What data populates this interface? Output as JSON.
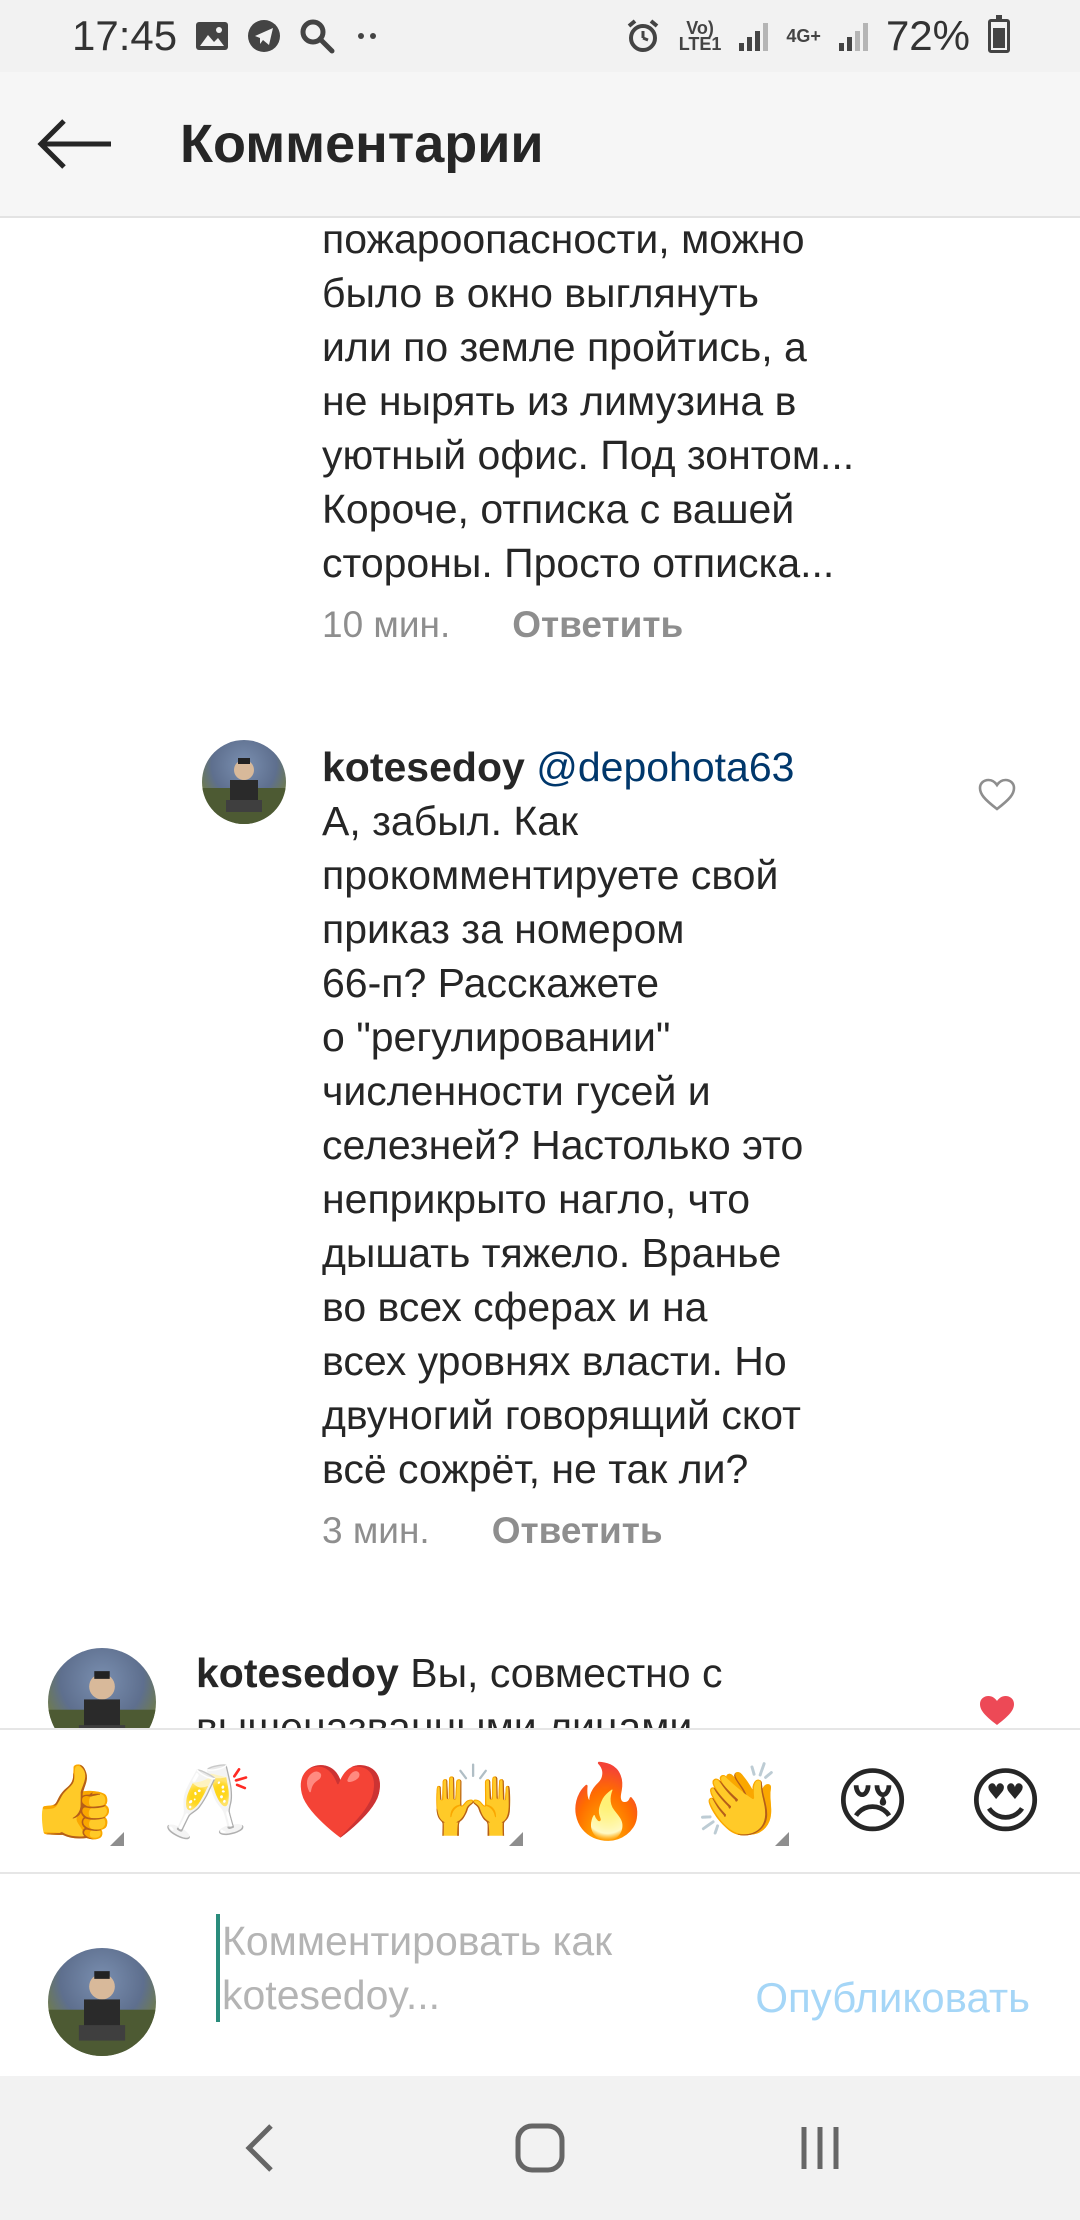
{
  "status_bar": {
    "time": "17:45",
    "battery": "72%",
    "lte_label_top": "Vo)",
    "lte_label_bottom": "LTE1",
    "net_label": "4G+",
    "icons": [
      "image-icon",
      "telegram-icon",
      "search-icon",
      "more-dots-icon",
      "alarm-icon",
      "signal-icon",
      "battery-icon"
    ]
  },
  "header": {
    "title": "Комментарии",
    "back_icon": "back-arrow-icon"
  },
  "comments": [
    {
      "text_lines": [
        "пожароопасности, можно",
        "было в окно выглянуть",
        "или по земле пройтись, а",
        "не нырять из лимузина в",
        "уютный офис. Под зонтом...",
        "Короче, отписка с вашей",
        "стороны. Просто отписка..."
      ],
      "time": "10 мин.",
      "reply_label": "Ответить"
    },
    {
      "username": "kotesedoy",
      "mention": "@depohota63",
      "text_lines": [
        "А, забыл. Как",
        "прокомментируете свой",
        "приказ за номером",
        "66-п? Расскажете",
        "о \"регулировании\"",
        "численности гусей и",
        "селезней? Настолько это",
        "неприкрыто нагло, что",
        "дышать тяжело. Вранье",
        "во всех сферах и на",
        "всех уровнях власти. Но",
        "двуногий говорящий скот",
        "всё сожрёт, не так ли?"
      ],
      "time": "3 мин.",
      "reply_label": "Ответить",
      "liked": false
    },
    {
      "username": "kotesedoy",
      "text_lines": [
        "Вы, совместно с",
        "вышеназванными лицами"
      ],
      "liked": true,
      "like_color": "#ed4956"
    }
  ],
  "emoji_bar": [
    {
      "glyph": "👍",
      "name": "thumbs-up-emoji",
      "has_variants": true
    },
    {
      "glyph": "🥂",
      "name": "clinking-glasses-emoji",
      "has_variants": false
    },
    {
      "glyph": "❤️",
      "name": "red-heart-emoji",
      "has_variants": false
    },
    {
      "glyph": "🙌",
      "name": "raising-hands-emoji",
      "has_variants": true
    },
    {
      "glyph": "🔥",
      "name": "fire-emoji",
      "has_variants": false
    },
    {
      "glyph": "👏",
      "name": "clapping-hands-emoji",
      "has_variants": true
    },
    {
      "glyph": "😢",
      "name": "crying-face-emoji",
      "has_variants": false
    },
    {
      "glyph": "😍",
      "name": "heart-eyes-emoji",
      "has_variants": false
    }
  ],
  "composer": {
    "placeholder_line1": "Комментировать как",
    "placeholder_line2": "kotesedoy...",
    "publish_label": "Опубликовать"
  },
  "nav": {
    "icons": [
      "back-nav-icon",
      "home-nav-icon",
      "recents-nav-icon"
    ]
  },
  "colors": {
    "mention": "#00376b",
    "meta": "#8e8e8e",
    "publish_disabled": "#a5d6f7",
    "like": "#ed4956"
  }
}
